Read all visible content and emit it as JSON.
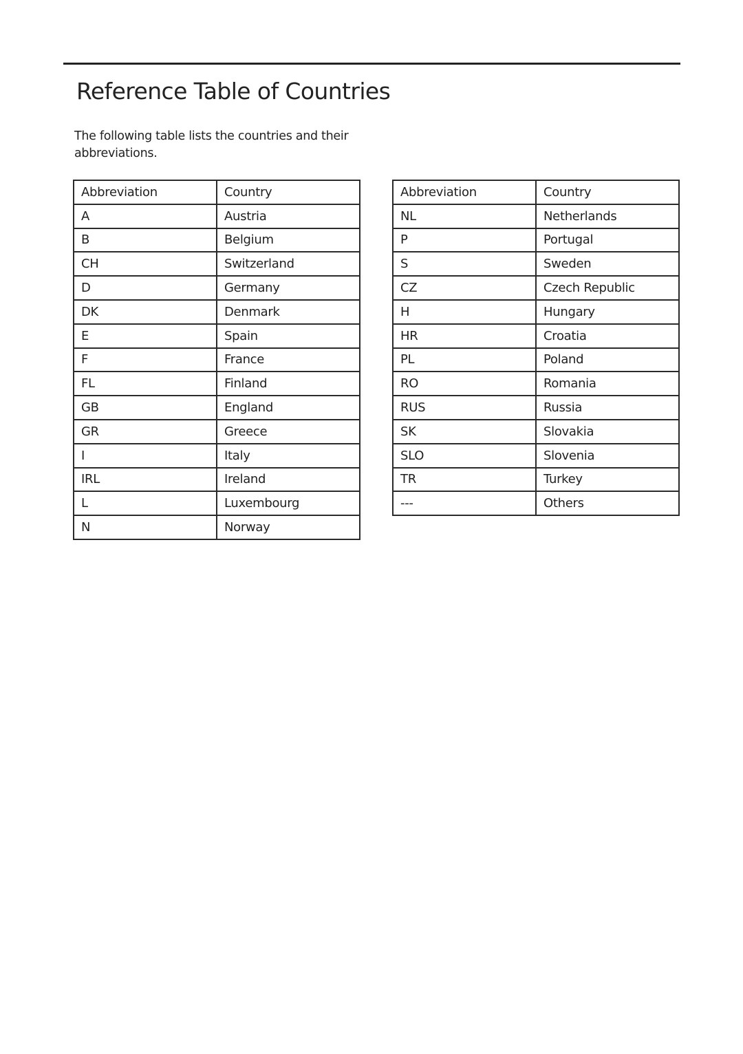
{
  "page": {
    "title": "Reference Table of Countries",
    "intro": "The following table lists the countries and their abbreviations."
  },
  "tables": {
    "headers": {
      "abbreviation": "Abbreviation",
      "country": "Country"
    },
    "left": [
      {
        "abbr": "A",
        "country": "Austria"
      },
      {
        "abbr": "B",
        "country": "Belgium"
      },
      {
        "abbr": "CH",
        "country": "Switzerland"
      },
      {
        "abbr": "D",
        "country": "Germany"
      },
      {
        "abbr": "DK",
        "country": "Denmark"
      },
      {
        "abbr": "E",
        "country": "Spain"
      },
      {
        "abbr": "F",
        "country": "France"
      },
      {
        "abbr": "FL",
        "country": "Finland"
      },
      {
        "abbr": "GB",
        "country": "England"
      },
      {
        "abbr": "GR",
        "country": "Greece"
      },
      {
        "abbr": "I",
        "country": "Italy"
      },
      {
        "abbr": "IRL",
        "country": "Ireland"
      },
      {
        "abbr": "L",
        "country": "Luxembourg"
      },
      {
        "abbr": "N",
        "country": "Norway"
      }
    ],
    "right": [
      {
        "abbr": "NL",
        "country": "Netherlands"
      },
      {
        "abbr": "P",
        "country": "Portugal"
      },
      {
        "abbr": "S",
        "country": "Sweden"
      },
      {
        "abbr": "CZ",
        "country": "Czech Republic"
      },
      {
        "abbr": "H",
        "country": "Hungary"
      },
      {
        "abbr": "HR",
        "country": "Croatia"
      },
      {
        "abbr": "PL",
        "country": "Poland"
      },
      {
        "abbr": "RO",
        "country": "Romania"
      },
      {
        "abbr": "RUS",
        "country": "Russia"
      },
      {
        "abbr": "SK",
        "country": "Slovakia"
      },
      {
        "abbr": "SLO",
        "country": "Slovenia"
      },
      {
        "abbr": "TR",
        "country": "Turkey"
      },
      {
        "abbr": "---",
        "country": "Others"
      }
    ]
  }
}
